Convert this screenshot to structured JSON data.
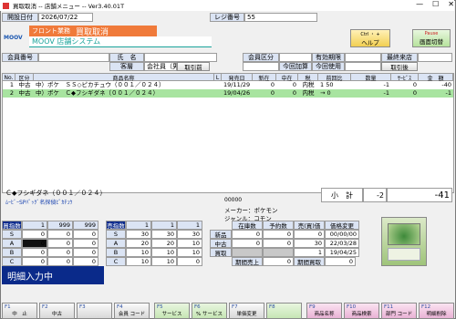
{
  "window": {
    "title": "買取取消 -- 店舗メニュー -- Ver3.40.01T",
    "min": "—",
    "max": "☐",
    "close": "✕"
  },
  "header": {
    "date_label": "開設日付",
    "date_value": "2026/07/22",
    "register_label": "レジ番号",
    "register_value": "55",
    "store_label": "フロント業務",
    "screen_title": "買取取消",
    "system_name": "MOOV 店舗システム",
    "logo_text": "MOOV",
    "help_button": "ヘルプ",
    "help_hint": "Ctrl ・ +",
    "screen_switch_button": "画面切替",
    "screen_switch_hint": "Pause"
  },
  "member": {
    "member_no_label": "会員番号",
    "member_no_value": "",
    "name_label": "氏　名",
    "name_value": "",
    "customer_label": "客層",
    "customer_value": "会社員（男",
    "cancel_button": "取引前",
    "member_class_label": "会員区分",
    "member_class_value": "",
    "used_this_time_label": "今回加算",
    "used_this_time_value": "",
    "expiry_label": "有効期限",
    "expiry_value": "",
    "last_visit_label": "最終来店",
    "last_visit_value": "",
    "this_use_label": "今回使用",
    "this_use_value": "",
    "history_button": "取引後"
  },
  "table": {
    "columns": [
      "No.",
      "区分",
      "商品名称",
      "L",
      "発売日",
      "新在",
      "中在",
      "税",
      "前回比",
      "数量",
      "ｻｰﾋﾞｽ",
      "金　額"
    ],
    "rows": [
      {
        "no": "1",
        "kubun": "中古",
        "name": "中）ポケ　ＳＳ◇ピカチュウ（００１／０２４）",
        "l": "",
        "release": "19/11/29",
        "new_stock": "0",
        "used_stock": "0",
        "tax": "内税",
        "prev": "1",
        "prev2": "50",
        "qty": "-1",
        "service": "0",
        "amount": "-40"
      },
      {
        "no": "2",
        "kubun": "中古",
        "name": "中）ポケ　Ｃ◆フシギダネ（００１／０２４）",
        "l": "",
        "release": "19/04/26",
        "new_stock": "0",
        "used_stock": "0",
        "tax": "内税",
        "prev": "→",
        "prev2": "0",
        "qty": "-1",
        "service": "0",
        "amount": "-1"
      }
    ]
  },
  "detail": {
    "product_name": "Ｃ◆フシギダネ（００１／０２４）",
    "product_sub": "ﾑｰﾋﾞｰSPﾊﾟｯｸﾞ名探偵ﾋﾟｶﾁｭｳ",
    "code": "00000",
    "maker_label": "メーカー：",
    "maker_value": "ポケモン",
    "genre_label": "ジャンル：",
    "genre_value": "コモン",
    "subtotal_label": "小　計",
    "subtotal_qty": "-2",
    "subtotal_amount": "-41"
  },
  "buy_rank": {
    "header": [
      "買指数",
      "1",
      "999",
      "999"
    ],
    "rows": [
      [
        "S",
        "0",
        "0",
        "0"
      ],
      [
        "A",
        "0",
        "0",
        "0"
      ],
      [
        "B",
        "0",
        "0",
        "0"
      ],
      [
        "C",
        "0",
        "0",
        "0"
      ]
    ]
  },
  "sell_rank": {
    "header": [
      "売指数",
      "1",
      "1",
      "1"
    ],
    "rows": [
      [
        "S",
        "30",
        "30",
        "30"
      ],
      [
        "A",
        "20",
        "20",
        "10"
      ],
      [
        "B",
        "10",
        "10",
        "10"
      ],
      [
        "C",
        "10",
        "10",
        "0"
      ]
    ]
  },
  "stock": {
    "headers": [
      "在庫数",
      "予約数",
      "売(買)価",
      "価格変更"
    ],
    "rows": [
      {
        "label": "新品",
        "stock": "0",
        "reserve": "0",
        "price": "0",
        "changed": "00/00/00"
      },
      {
        "label": "中古",
        "stock": "0",
        "reserve": "0",
        "price": "30",
        "changed": "22/03/28"
      },
      {
        "label": "買取",
        "stock": "",
        "reserve": "",
        "price": "1",
        "changed": "19/04/25"
      }
    ],
    "period_sales_label": "期間売上",
    "period_sales_value": "0",
    "period_buy_label": "期間買取",
    "period_buy_value": "0"
  },
  "status_text": "明細入力中",
  "fkeys": [
    {
      "key": "F1",
      "label": "中　止"
    },
    {
      "key": "F2",
      "label": "中古"
    },
    {
      "key": "F3",
      "label": ""
    },
    {
      "key": "F4",
      "label": "会員\nコード"
    },
    {
      "key": "F5",
      "label": "サービス"
    },
    {
      "key": "F6",
      "label": "%\nサービス"
    },
    {
      "key": "F7",
      "label": "単価変更"
    },
    {
      "key": "F8",
      "label": ""
    },
    {
      "key": "F9",
      "label": "商品名称"
    },
    {
      "key": "F10",
      "label": "商品検索"
    },
    {
      "key": "F11",
      "label": "部門\nコード"
    },
    {
      "key": "F12",
      "label": "明細削除"
    }
  ],
  "colors": {
    "accent_orange": "#f07a3a",
    "title_teal": "#1aa39a",
    "selection_green": "#a8e4a0",
    "status_bg": "#0a2a8a"
  }
}
